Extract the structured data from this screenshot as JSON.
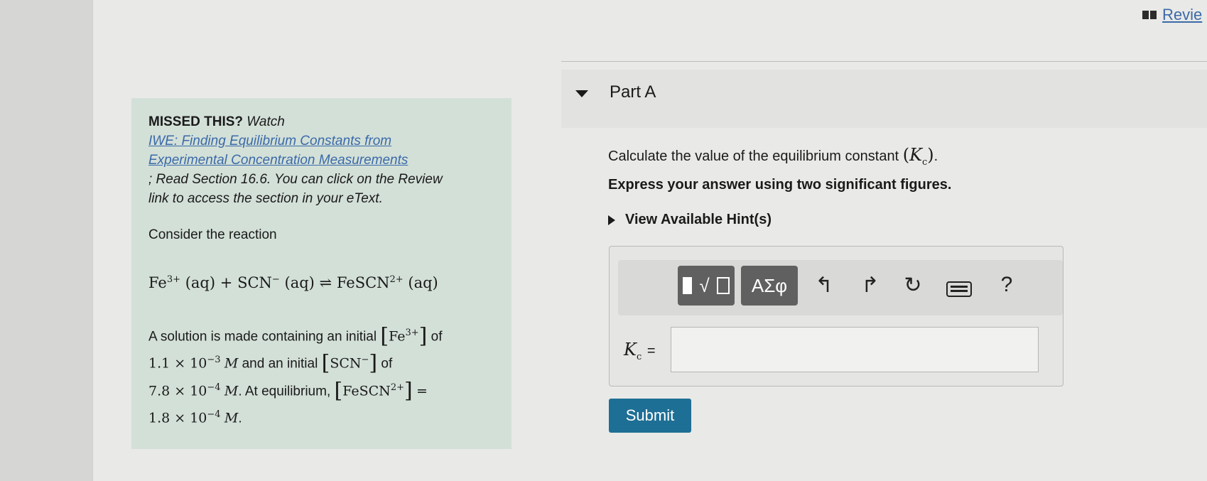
{
  "review_link": "Revie",
  "info": {
    "missed": "MISSED THIS?",
    "watch": "Watch",
    "video_link_line1": "IWE: Finding Equilibrium Constants from",
    "video_link_line2": "Experimental Concentration Measurements",
    "read_line1": "; Read Section 16.6. You can click on the Review",
    "read_line2": "link to access the section in your eText.",
    "consider": "Consider the reaction",
    "reaction": {
      "fe": "Fe",
      "fe_charge": "3+",
      "aq": "(aq)",
      "plus": "+",
      "scn": "SCN",
      "scn_charge": "−",
      "arrow": "⇌",
      "product": "FeSCN",
      "product_charge": "2+"
    },
    "solution": {
      "t1": "A solution is made containing an initial",
      "t_of": "of",
      "fe_conc": "1.1 × 10",
      "fe_exp": "−3",
      "unit_m": "M",
      "t2": "and an initial",
      "scn_conc": "7.8 × 10",
      "scn_exp": "−4",
      "t3": ". At equilibrium,",
      "eq": "=",
      "prod_conc": "1.8 × 10",
      "prod_exp": "−4",
      "period": "."
    }
  },
  "part": {
    "title": "Part A",
    "question_text": "Calculate the value of the equilibrium constant",
    "k_symbol": "K",
    "k_sub": "c",
    "express": "Express your answer using two significant figures.",
    "hint": "View Available Hint(s)",
    "k_label_eq": "=",
    "answer_value": "",
    "submit": "Submit"
  },
  "toolbar": {
    "greek_label": "ΑΣφ",
    "help_label": "?"
  }
}
